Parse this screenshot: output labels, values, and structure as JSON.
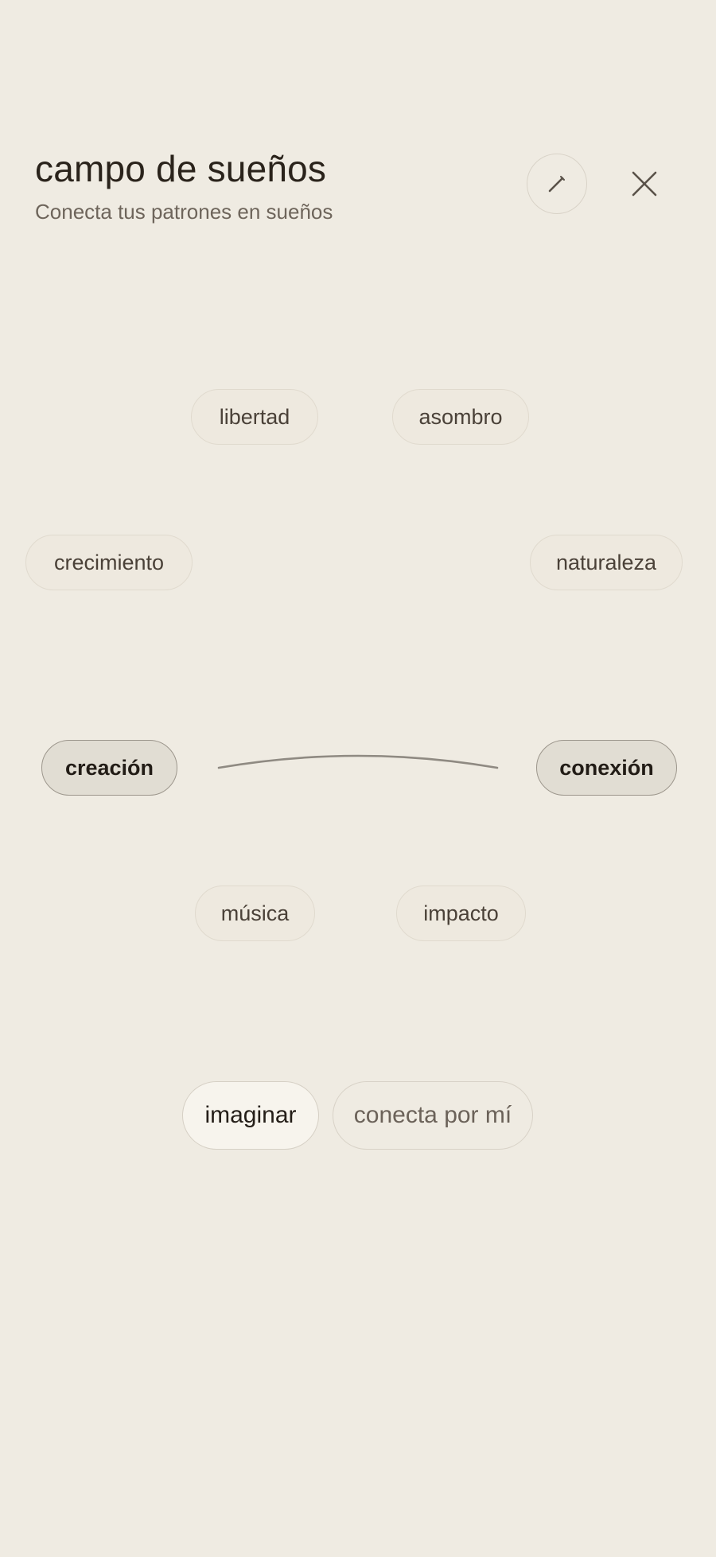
{
  "header": {
    "title": "campo de sueños",
    "subtitle": "Conecta tus patrones en sueños"
  },
  "icons": {
    "edit": "pencil-icon",
    "close": "close-icon"
  },
  "chips": [
    {
      "id": "libertad",
      "label": "libertad",
      "selected": false
    },
    {
      "id": "asombro",
      "label": "asombro",
      "selected": false
    },
    {
      "id": "crecimiento",
      "label": "crecimiento",
      "selected": false
    },
    {
      "id": "naturaleza",
      "label": "naturaleza",
      "selected": false
    },
    {
      "id": "creacion",
      "label": "creación",
      "selected": true
    },
    {
      "id": "conexion",
      "label": "conexión",
      "selected": true
    },
    {
      "id": "musica",
      "label": "música",
      "selected": false
    },
    {
      "id": "impacto",
      "label": "impacto",
      "selected": false
    }
  ],
  "connection": {
    "from": "creación",
    "to": "conexión"
  },
  "actions": {
    "primary_label": "imaginar",
    "secondary_label": "conecta por mí"
  },
  "colors": {
    "background": "#efebe2",
    "chip_border": "#e0dace",
    "selected_chip_bg": "#e1ddd3",
    "connector_line": "#8f8a82"
  }
}
